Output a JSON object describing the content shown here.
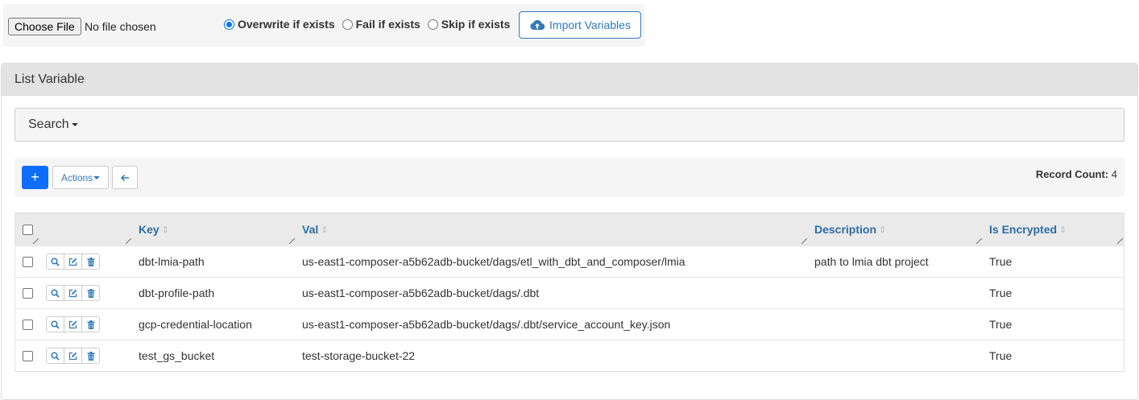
{
  "import_bar": {
    "choose_file_label": "Choose File",
    "file_status": "No file chosen",
    "options": [
      {
        "label": "Overwrite if exists",
        "checked": true
      },
      {
        "label": "Fail if exists",
        "checked": false
      },
      {
        "label": "Skip if exists",
        "checked": false
      }
    ],
    "import_button_label": "Import Variables",
    "import_icon": "cloud-upload-icon"
  },
  "panel": {
    "title": "List Variable",
    "search_label": "Search",
    "toolbar": {
      "add_label": "+",
      "actions_label": "Actions",
      "back_icon": "arrow-left-icon",
      "record_count_label": "Record Count:",
      "record_count_value": "4"
    }
  },
  "table": {
    "columns": [
      "Key",
      "Val",
      "Description",
      "Is Encrypted"
    ],
    "rows": [
      {
        "key": "dbt-lmia-path",
        "val": "us-east1-composer-a5b62adb-bucket/dags/etl_with_dbt_and_composer/lmia",
        "description": "path to lmia dbt project",
        "is_encrypted": "True"
      },
      {
        "key": "dbt-profile-path",
        "val": "us-east1-composer-a5b62adb-bucket/dags/.dbt",
        "description": "",
        "is_encrypted": "True"
      },
      {
        "key": "gcp-credential-location",
        "val": "us-east1-composer-a5b62adb-bucket/dags/.dbt/service_account_key.json",
        "description": "",
        "is_encrypted": "True"
      },
      {
        "key": "test_gs_bucket",
        "val": "test-storage-bucket-22",
        "description": "",
        "is_encrypted": "True"
      }
    ],
    "row_action_icons": [
      "search-icon",
      "edit-icon",
      "trash-icon"
    ]
  },
  "colors": {
    "accent": "#0d6efd",
    "link": "#337ab7",
    "header_text": "#2c6da3"
  }
}
